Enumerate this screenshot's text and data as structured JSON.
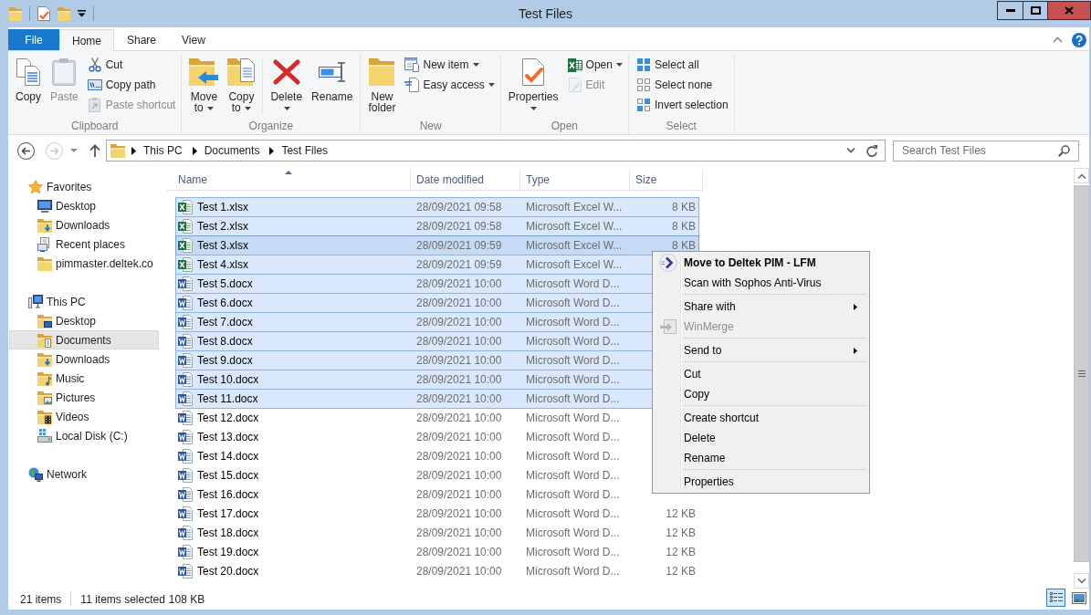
{
  "window": {
    "title": "Test Files"
  },
  "ribbon": {
    "tabs": [
      {
        "label": "File",
        "kind": "file",
        "selected": false
      },
      {
        "label": "Home",
        "kind": "tab",
        "selected": true
      },
      {
        "label": "Share",
        "kind": "tab",
        "selected": false
      },
      {
        "label": "View",
        "kind": "tab",
        "selected": false
      }
    ],
    "groups": [
      {
        "label": "Clipboard",
        "items": [
          {
            "label": "Copy",
            "kind": "large",
            "disabled": false,
            "dropdown": false
          },
          {
            "label": "Paste",
            "kind": "large",
            "disabled": true,
            "dropdown": false
          },
          {
            "label": "Cut",
            "kind": "small",
            "disabled": false,
            "dropdown": false
          },
          {
            "label": "Copy path",
            "kind": "small",
            "disabled": false,
            "dropdown": false
          },
          {
            "label": "Paste shortcut",
            "kind": "small",
            "disabled": true,
            "dropdown": false
          }
        ]
      },
      {
        "label": "Organize",
        "items": [
          {
            "label": "Move to",
            "kind": "large",
            "disabled": false,
            "dropdown": true
          },
          {
            "label": "Copy to",
            "kind": "large",
            "disabled": false,
            "dropdown": true
          },
          {
            "kind": "separator"
          },
          {
            "label": "Delete",
            "kind": "large",
            "disabled": false,
            "dropdown": true
          },
          {
            "label": "Rename",
            "kind": "large",
            "disabled": false,
            "dropdown": false
          }
        ]
      },
      {
        "label": "New",
        "items": [
          {
            "label": "New folder",
            "kind": "large",
            "disabled": false,
            "dropdown": false
          },
          {
            "label": "New item",
            "kind": "small",
            "disabled": false,
            "dropdown": true
          },
          {
            "label": "Easy access",
            "kind": "small",
            "disabled": false,
            "dropdown": true
          }
        ]
      },
      {
        "label": "Open",
        "items": [
          {
            "label": "Properties",
            "kind": "large",
            "disabled": false,
            "dropdown": true
          },
          {
            "label": "Open",
            "kind": "small",
            "disabled": false,
            "dropdown": true
          },
          {
            "label": "Edit",
            "kind": "small",
            "disabled": true,
            "dropdown": false
          }
        ]
      },
      {
        "label": "Select",
        "items": [
          {
            "label": "Select all",
            "kind": "small",
            "disabled": false,
            "dropdown": false
          },
          {
            "label": "Select none",
            "kind": "small",
            "disabled": false,
            "dropdown": false
          },
          {
            "label": "Invert selection",
            "kind": "small",
            "disabled": false,
            "dropdown": false
          }
        ]
      }
    ]
  },
  "address_bar": {
    "back": {
      "disabled": false
    },
    "forward": {
      "disabled": true
    },
    "up": {
      "disabled": false
    },
    "path": [
      "This PC",
      "Documents",
      "Test Files"
    ]
  },
  "search": {
    "placeholder": "Search Test Files"
  },
  "nav_pane": {
    "items": [
      {
        "label": "Favorites",
        "selected": false,
        "children": [
          {
            "label": "Desktop",
            "selected": false
          },
          {
            "label": "Downloads",
            "selected": false
          },
          {
            "label": "Recent places",
            "selected": false
          },
          {
            "label": "pimmaster.deltek.co",
            "selected": false
          }
        ]
      },
      {
        "label": "This PC",
        "selected": false,
        "children": [
          {
            "label": "Desktop",
            "selected": false
          },
          {
            "label": "Documents",
            "selected": true
          },
          {
            "label": "Downloads",
            "selected": false
          },
          {
            "label": "Music",
            "selected": false
          },
          {
            "label": "Pictures",
            "selected": false
          },
          {
            "label": "Videos",
            "selected": false
          },
          {
            "label": "Local Disk (C:)",
            "selected": false
          }
        ]
      },
      {
        "label": "Network",
        "selected": false
      }
    ]
  },
  "file_list": {
    "columns": [
      {
        "label": "Name",
        "sorted": true
      },
      {
        "label": "Date modified",
        "sorted": false
      },
      {
        "label": "Type",
        "sorted": false
      },
      {
        "label": "Size",
        "sorted": false
      }
    ],
    "rows": [
      {
        "kind": "excel",
        "name": "Test 1.xlsx",
        "date_modified": "28/09/2021 09:58",
        "type": "Microsoft Excel W...",
        "size": "8 KB",
        "selected": true,
        "focused": false
      },
      {
        "kind": "excel",
        "name": "Test 2.xlsx",
        "date_modified": "28/09/2021 09:58",
        "type": "Microsoft Excel W...",
        "size": "8 KB",
        "selected": true,
        "focused": false
      },
      {
        "kind": "excel",
        "name": "Test 3.xlsx",
        "date_modified": "28/09/2021 09:59",
        "type": "Microsoft Excel W...",
        "size": "8 KB",
        "selected": true,
        "focused": true
      },
      {
        "kind": "excel",
        "name": "Test 4.xlsx",
        "date_modified": "28/09/2021 09:59",
        "type": "Microsoft Excel W...",
        "selected": true,
        "focused": false
      },
      {
        "kind": "word",
        "name": "Test 5.docx",
        "date_modified": "28/09/2021 10:00",
        "type": "Microsoft Word D...",
        "selected": true,
        "focused": false
      },
      {
        "kind": "word",
        "name": "Test 6.docx",
        "date_modified": "28/09/2021 10:00",
        "type": "Microsoft Word D...",
        "selected": true,
        "focused": false
      },
      {
        "kind": "word",
        "name": "Test 7.docx",
        "date_modified": "28/09/2021 10:00",
        "type": "Microsoft Word D...",
        "selected": true,
        "focused": false
      },
      {
        "kind": "word",
        "name": "Test 8.docx",
        "date_modified": "28/09/2021 10:00",
        "type": "Microsoft Word D...",
        "selected": true,
        "focused": false
      },
      {
        "kind": "word",
        "name": "Test 9.docx",
        "date_modified": "28/09/2021 10:00",
        "type": "Microsoft Word D...",
        "selected": true,
        "focused": false
      },
      {
        "kind": "word",
        "name": "Test 10.docx",
        "date_modified": "28/09/2021 10:00",
        "type": "Microsoft Word D...",
        "selected": true,
        "focused": false
      },
      {
        "kind": "word",
        "name": "Test 11.docx",
        "date_modified": "28/09/2021 10:00",
        "type": "Microsoft Word D...",
        "selected": true,
        "focused": false
      },
      {
        "kind": "word",
        "name": "Test 12.docx",
        "date_modified": "28/09/2021 10:00",
        "type": "Microsoft Word D...",
        "selected": false,
        "focused": false
      },
      {
        "kind": "word",
        "name": "Test 13.docx",
        "date_modified": "28/09/2021 10:00",
        "type": "Microsoft Word D...",
        "selected": false,
        "focused": false
      },
      {
        "kind": "word",
        "name": "Test 14.docx",
        "date_modified": "28/09/2021 10:00",
        "type": "Microsoft Word D...",
        "selected": false,
        "focused": false
      },
      {
        "kind": "word",
        "name": "Test 15.docx",
        "date_modified": "28/09/2021 10:00",
        "type": "Microsoft Word D...",
        "selected": false,
        "focused": false
      },
      {
        "kind": "word",
        "name": "Test 16.docx",
        "date_modified": "28/09/2021 10:00",
        "type": "Microsoft Word D...",
        "selected": false,
        "focused": false
      },
      {
        "kind": "word",
        "name": "Test 17.docx",
        "date_modified": "28/09/2021 10:00",
        "type": "Microsoft Word D...",
        "size": "12 KB",
        "selected": false,
        "focused": false
      },
      {
        "kind": "word",
        "name": "Test 18.docx",
        "date_modified": "28/09/2021 10:00",
        "type": "Microsoft Word D...",
        "size": "12 KB",
        "selected": false,
        "focused": false
      },
      {
        "kind": "word",
        "name": "Test 19.docx",
        "date_modified": "28/09/2021 10:00",
        "type": "Microsoft Word D...",
        "size": "12 KB",
        "selected": false,
        "focused": false
      },
      {
        "kind": "word",
        "name": "Test 20.docx",
        "date_modified": "28/09/2021 10:00",
        "type": "Microsoft Word D...",
        "size": "12 KB",
        "selected": false,
        "focused": false
      }
    ]
  },
  "context_menu": {
    "groups": [
      {
        "items": [
          {
            "label": "Move to Deltek PIM - LFM",
            "default": true,
            "disabled": false,
            "submenu": false
          },
          {
            "label": "Scan with Sophos Anti-Virus",
            "default": false,
            "disabled": false,
            "submenu": false
          }
        ]
      },
      {
        "items": [
          {
            "label": "Share with",
            "default": false,
            "disabled": false,
            "submenu": true
          },
          {
            "label": "WinMerge",
            "default": false,
            "disabled": true,
            "submenu": false
          }
        ]
      },
      {
        "items": [
          {
            "label": "Send to",
            "default": false,
            "disabled": false,
            "submenu": true
          }
        ]
      },
      {
        "items": [
          {
            "label": "Cut",
            "default": false,
            "disabled": false,
            "submenu": false
          },
          {
            "label": "Copy",
            "default": false,
            "disabled": false,
            "submenu": false
          }
        ]
      },
      {
        "items": [
          {
            "label": "Create shortcut",
            "default": false,
            "disabled": false,
            "submenu": false
          },
          {
            "label": "Delete",
            "default": false,
            "disabled": false,
            "submenu": false
          },
          {
            "label": "Rename",
            "default": false,
            "disabled": false,
            "submenu": false
          }
        ]
      },
      {
        "items": [
          {
            "label": "Properties",
            "default": false,
            "disabled": false,
            "submenu": false
          }
        ]
      }
    ]
  },
  "status_bar": {
    "item_count": "21 items",
    "selected_count": "11 items selected",
    "selected_size": "108 KB",
    "views": [
      {
        "selected": true
      },
      {
        "selected": false
      }
    ]
  }
}
